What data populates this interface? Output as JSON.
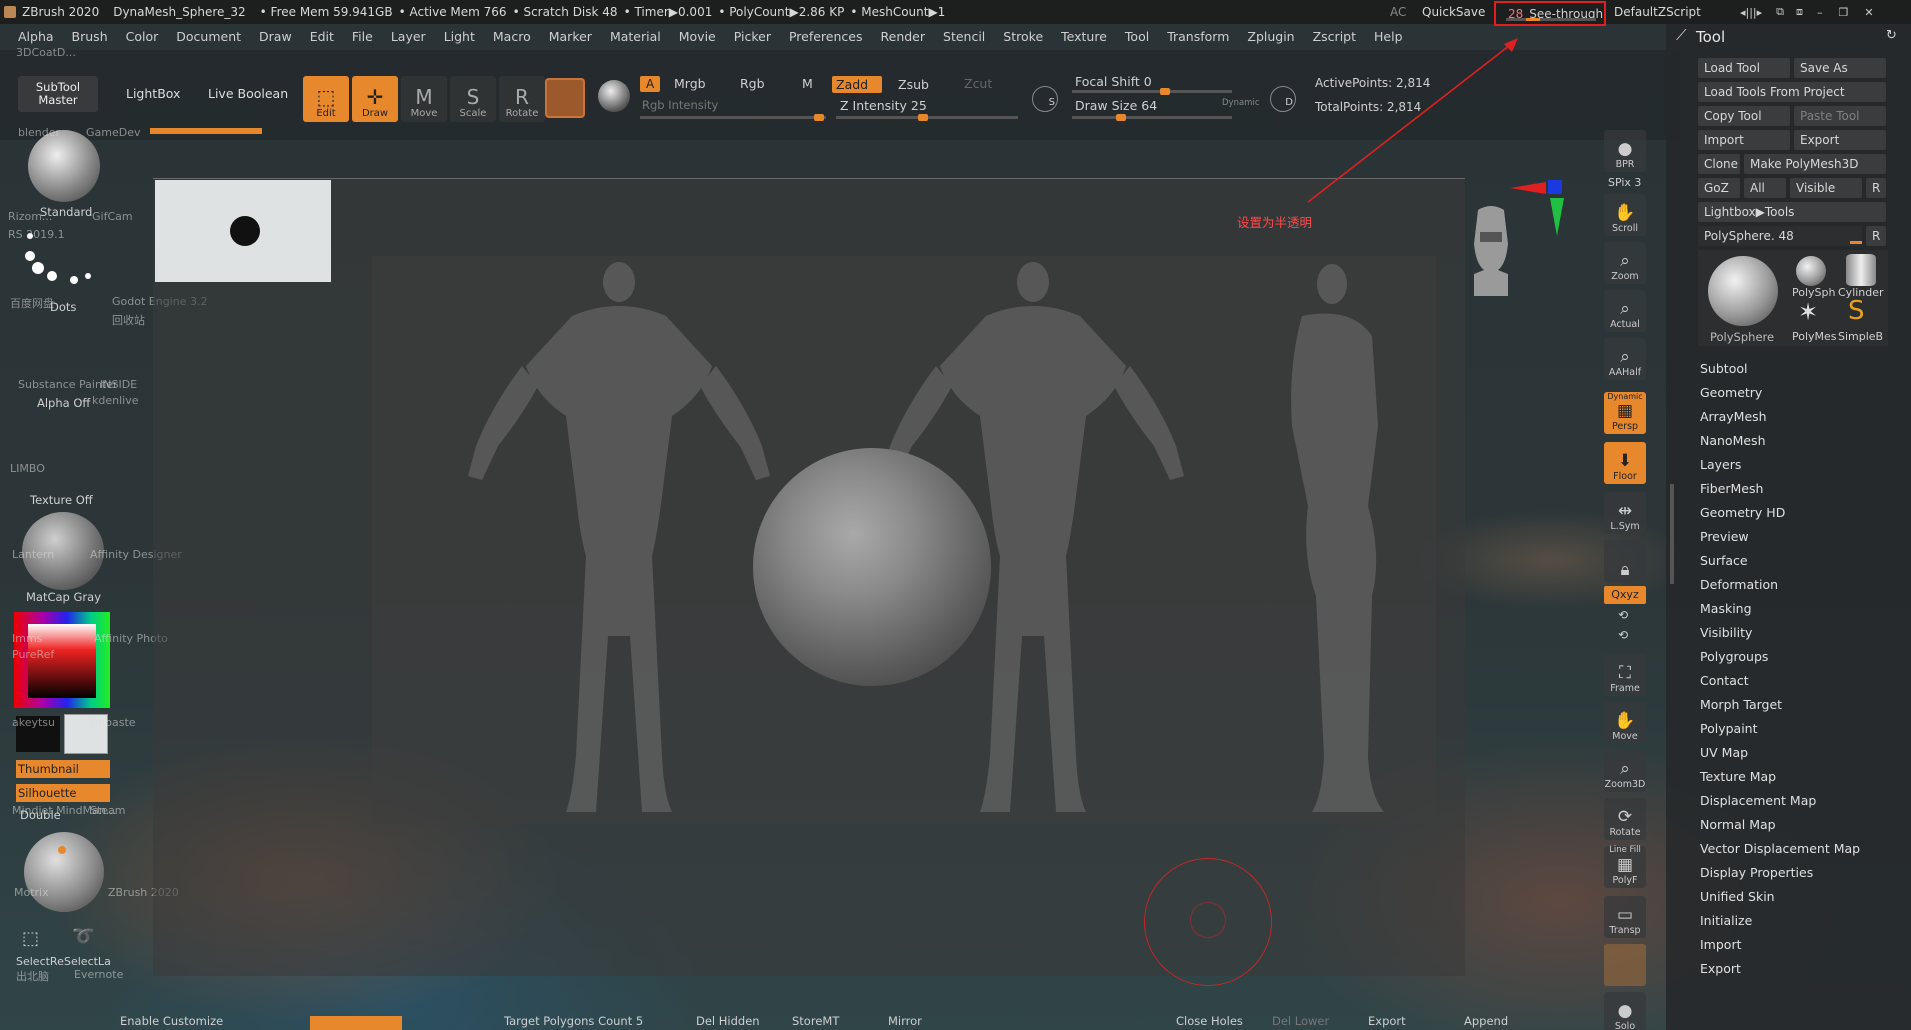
{
  "titlebar": {
    "app": "ZBrush 2020",
    "doc": "DynaMesh_Sphere_32",
    "free_mem": "• Free Mem 59.941GB",
    "active_mem": "• Active Mem 766",
    "scratch": "• Scratch Disk 48",
    "timer": "• Timer▶0.001",
    "polycount": "• PolyCount▶2.86 KP",
    "meshcount": "• MeshCount▶1",
    "ac": "AC",
    "quicksave": "QuickSave",
    "seethrough_value": "28",
    "seethrough_label": "See-through",
    "seethrough_fraction": 0.28,
    "script": "DefaultZScript"
  },
  "menu": [
    "Alpha",
    "Brush",
    "Color",
    "Document",
    "Draw",
    "Edit",
    "File",
    "Layer",
    "Light",
    "Macro",
    "Marker",
    "Material",
    "Movie",
    "Picker",
    "Preferences",
    "Render",
    "Stencil",
    "Stroke",
    "Texture",
    "Tool",
    "Transform",
    "Zplugin",
    "Zscript",
    "Help"
  ],
  "toolbar": {
    "subtool_master": "SubTool Master",
    "lightbox": "LightBox",
    "live_boolean": "Live Boolean",
    "edit": "Edit",
    "draw": "Draw",
    "move": "Move",
    "scale": "Scale",
    "rotate": "Rotate",
    "a": "A",
    "mrgb": "Mrgb",
    "rgb": "Rgb",
    "m": "M",
    "rgb_intensity": "Rgb Intensity",
    "zadd": "Zadd",
    "zsub": "Zsub",
    "zcut": "Zcut",
    "z_intensity": "Z Intensity 25",
    "focal_shift": "Focal Shift 0",
    "draw_size": "Draw Size 64",
    "dynamic": "Dynamic",
    "active_points": "ActivePoints: 2,814",
    "total_points": "TotalPoints: 2,814"
  },
  "leftshelf": {
    "standard": "Standard",
    "dots": "Dots",
    "alpha_off": "Alpha Off",
    "texture_off": "Texture Off",
    "matcap": "MatCap Gray",
    "thumbnail": "Thumbnail",
    "silhouette": "Silhouette",
    "double": "Double",
    "selectrect": "SelectRe",
    "selectlasso": "SelectLa"
  },
  "desktop_labels": [
    "blender",
    "GameDev",
    "Rizom...",
    "GifCam",
    "RS 2019.1",
    "百度网盘",
    "Godot Engine 3.2",
    "回收站",
    "Substance Painter",
    "INSIDE",
    "kdenlive",
    "LIMBO",
    "Lantern",
    "Affinity Designer",
    "Imms",
    "Affinity Photo",
    "PureRef",
    "akeytsu",
    "Snipaste",
    "Mindjet MindMan...",
    "Steam",
    "Motrix",
    "ZBrush 2020",
    "出北脑",
    "Evernote",
    "3DCoatD..."
  ],
  "annotation": "设置为半透明",
  "navcol": {
    "bpr": "BPR",
    "spix": "SPix 3",
    "scroll": "Scroll",
    "zoom": "Zoom",
    "actual": "Actual",
    "aahalf": "AAHalf",
    "dynamic": "Dynamic",
    "persp": "Persp",
    "floor": "Floor",
    "lsym": "L.Sym",
    "xyz": "Qxyz",
    "frame": "Frame",
    "move": "Move",
    "zoom3d": "Zoom3D",
    "rotate": "Rotate",
    "linefill": "Line Fill",
    "polyf": "PolyF",
    "transp": "Transp",
    "solo": "Solo"
  },
  "palette": {
    "title": "Tool",
    "load_tool": "Load Tool",
    "save_as": "Save As",
    "load_project": "Load Tools From Project",
    "copy_tool": "Copy Tool",
    "paste_tool": "Paste Tool",
    "import": "Import",
    "export": "Export",
    "clone": "Clone",
    "make_polymesh": "Make PolyMesh3D",
    "goz": "GoZ",
    "all": "All",
    "visible": "Visible",
    "r": "R",
    "lightbox_tools": "Lightbox▶Tools",
    "current_tool": "PolySphere. 48",
    "thumbs": [
      "PolySphere",
      "PolySph",
      "Cylinder",
      "PolyMes",
      "SimpleB"
    ],
    "sections": [
      "Subtool",
      "Geometry",
      "ArrayMesh",
      "NanoMesh",
      "Layers",
      "FiberMesh",
      "Geometry HD",
      "Preview",
      "Surface",
      "Deformation",
      "Masking",
      "Visibility",
      "Polygroups",
      "Contact",
      "Morph Target",
      "Polypaint",
      "UV Map",
      "Texture Map",
      "Displacement Map",
      "Normal Map",
      "Vector Displacement Map",
      "Display Properties",
      "Unified Skin",
      "Initialize",
      "Import",
      "Export"
    ]
  },
  "bottombar": {
    "enable_customize": "Enable Customize",
    "target_polys": "Target Polygons Count 5",
    "del_hidden": "Del Hidden",
    "storemt": "StoreMT",
    "mirror": "Mirror",
    "close_holes": "Close Holes",
    "del_lower": "Del Lower",
    "export": "Export",
    "append": "Append"
  }
}
